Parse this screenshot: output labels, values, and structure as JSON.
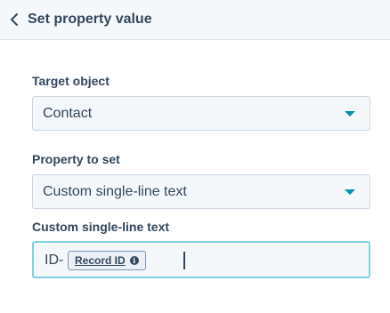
{
  "header": {
    "title": "Set property value",
    "back_icon": "chevron-left-icon"
  },
  "target_object": {
    "label": "Target object",
    "value": "Contact"
  },
  "property_to_set": {
    "label": "Property to set",
    "value": "Custom single-line text"
  },
  "custom_field": {
    "label": "Custom single-line text",
    "prefix": "ID-",
    "token_label": "Record ID",
    "token_icon": "info-icon",
    "info_glyph": "i"
  },
  "colors": {
    "header_bg": "#f5f8fa",
    "text": "#33475b",
    "accent": "#0091ae",
    "focus_border": "#7fd1de",
    "field_border": "#cbd6e2"
  }
}
